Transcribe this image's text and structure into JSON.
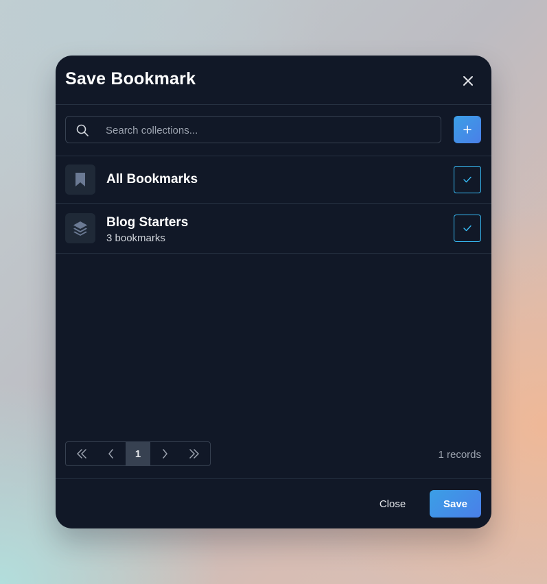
{
  "dialog": {
    "title": "Save Bookmark",
    "close_icon": "close-icon"
  },
  "search": {
    "placeholder": "Search collections...",
    "value": "",
    "icon": "search-icon",
    "add_icon": "plus-icon"
  },
  "collections": [
    {
      "title": "All Bookmarks",
      "subtitle": "",
      "icon": "bookmark-icon",
      "checked": true
    },
    {
      "title": "Blog Starters",
      "subtitle": "3 bookmarks",
      "icon": "layers-icon",
      "checked": true
    }
  ],
  "pagination": {
    "current_page": "1",
    "records_text": "1 records",
    "icons": [
      "double-chevron-left-icon",
      "chevron-left-icon",
      "chevron-right-icon",
      "double-chevron-right-icon"
    ]
  },
  "footer": {
    "close_label": "Close",
    "save_label": "Save"
  },
  "colors": {
    "modal_bg": "#111827",
    "accent": "#3b9fe6",
    "check_border": "#38bdf8",
    "divider": "#263141"
  }
}
